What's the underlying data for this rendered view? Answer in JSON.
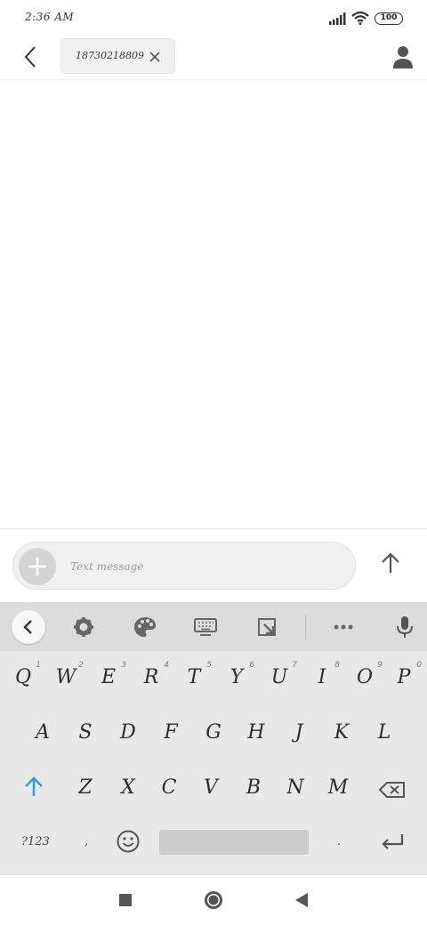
{
  "status_bar": {
    "time": "2:36 AM",
    "battery": "100",
    "icons": [
      "signal-icon",
      "wifi-icon",
      "battery-icon"
    ]
  },
  "header": {
    "back_icon": "chevron-left-icon",
    "recipient": "18730218809",
    "recipient_remove_icon": "close-icon",
    "contact_icon": "person-icon"
  },
  "compose": {
    "add_icon": "plus-icon",
    "placeholder": "Text message",
    "value": "",
    "send_icon": "arrow-up-icon"
  },
  "keyboard": {
    "toolbar": [
      "chevron-left-icon",
      "gear-icon",
      "palette-icon",
      "keyboard-icon",
      "resize-icon",
      "more-icon",
      "microphone-icon"
    ],
    "row1": [
      {
        "label": "Q",
        "hint": "1"
      },
      {
        "label": "W",
        "hint": "2"
      },
      {
        "label": "E",
        "hint": "3"
      },
      {
        "label": "R",
        "hint": "4"
      },
      {
        "label": "T",
        "hint": "5"
      },
      {
        "label": "Y",
        "hint": "6"
      },
      {
        "label": "U",
        "hint": "7"
      },
      {
        "label": "I",
        "hint": "8"
      },
      {
        "label": "O",
        "hint": "9"
      },
      {
        "label": "P",
        "hint": "0"
      }
    ],
    "row2": [
      "A",
      "S",
      "D",
      "F",
      "G",
      "H",
      "J",
      "K",
      "L"
    ],
    "row3": [
      "Z",
      "X",
      "C",
      "V",
      "B",
      "N",
      "M"
    ],
    "symbols_label": "?123",
    "comma": ",",
    "period": ".",
    "accent_color": "#2f9ae0"
  },
  "nav_bar": {
    "icons": [
      "recents-square-icon",
      "home-circle-icon",
      "back-triangle-icon"
    ]
  }
}
